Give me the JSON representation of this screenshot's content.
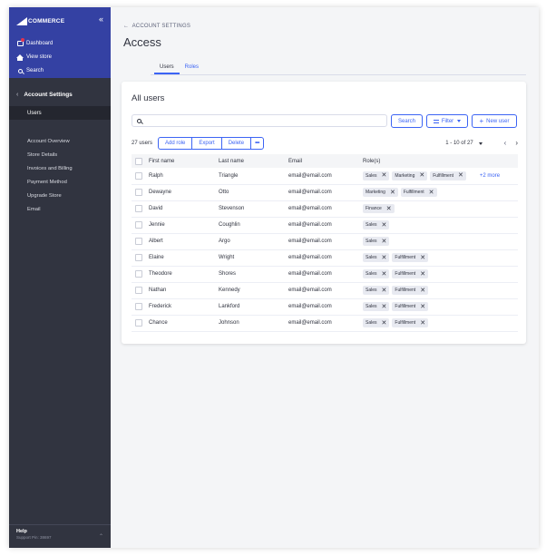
{
  "sidebar": {
    "brand": "COMMERCE",
    "nav": [
      {
        "label": "Dashboard",
        "icon": "dashboard-icon"
      },
      {
        "label": "View store",
        "icon": "home-icon"
      },
      {
        "label": "Search",
        "icon": "search-icon"
      }
    ],
    "section_title": "Account Settings",
    "active_item": "Users",
    "items": [
      "Account Overview",
      "Store Details",
      "Invoices and Billing",
      "Payment Method",
      "Upgrade Store",
      "Email"
    ],
    "footer": {
      "help": "Help",
      "support": "Support Pin: 38697"
    }
  },
  "header": {
    "breadcrumb": "ACCOUNT SETTINGS",
    "title": "Access",
    "tabs": [
      {
        "label": "Users",
        "active": true
      },
      {
        "label": "Roles",
        "active": false
      }
    ]
  },
  "card": {
    "title": "All users",
    "search": {
      "value": "",
      "placeholder": "",
      "button": "Search"
    },
    "filter_label": "Filter",
    "new_user_label": "New user",
    "toolbar": {
      "count": "27 users",
      "add_role": "Add role",
      "export": "Export",
      "delete": "Delete",
      "more": "•••"
    },
    "pagination": "1 - 10 of 27",
    "columns": [
      "First name",
      "Last name",
      "Email",
      "Role(s)"
    ],
    "rows": [
      {
        "first": "Ralph",
        "last": "Triangle",
        "email": "email@email.com",
        "roles": [
          "Sales",
          "Marketing",
          "Fulfillment"
        ],
        "more": "+2 more"
      },
      {
        "first": "Dewayne",
        "last": "Otto",
        "email": "email@email.com",
        "roles": [
          "Marketing",
          "Fulfillment"
        ],
        "more": ""
      },
      {
        "first": "David",
        "last": "Stevenson",
        "email": "email@email.com",
        "roles": [
          "Finance"
        ],
        "more": ""
      },
      {
        "first": "Jennie",
        "last": "Coughlin",
        "email": "email@email.com",
        "roles": [
          "Sales"
        ],
        "more": ""
      },
      {
        "first": "Albert",
        "last": "Argo",
        "email": "email@email.com",
        "roles": [
          "Sales"
        ],
        "more": ""
      },
      {
        "first": "Elaine",
        "last": "Wright",
        "email": "email@email.com",
        "roles": [
          "Sales",
          "Fulfillment"
        ],
        "more": ""
      },
      {
        "first": "Theodore",
        "last": "Shores",
        "email": "email@email.com",
        "roles": [
          "Sales",
          "Fulfillment"
        ],
        "more": ""
      },
      {
        "first": "Nathan",
        "last": "Kennedy",
        "email": "email@email.com",
        "roles": [
          "Sales",
          "Fulfillment"
        ],
        "more": ""
      },
      {
        "first": "Frederick",
        "last": "Lankford",
        "email": "email@email.com",
        "roles": [
          "Sales",
          "Fulfillment"
        ],
        "more": ""
      },
      {
        "first": "Chance",
        "last": "Johnson",
        "email": "email@email.com",
        "roles": [
          "Sales",
          "Fulfillment"
        ],
        "more": ""
      }
    ]
  },
  "colors": {
    "accent": "#3c64f4",
    "sidebar": "#313440",
    "sidebar_top": "#3441a3"
  }
}
